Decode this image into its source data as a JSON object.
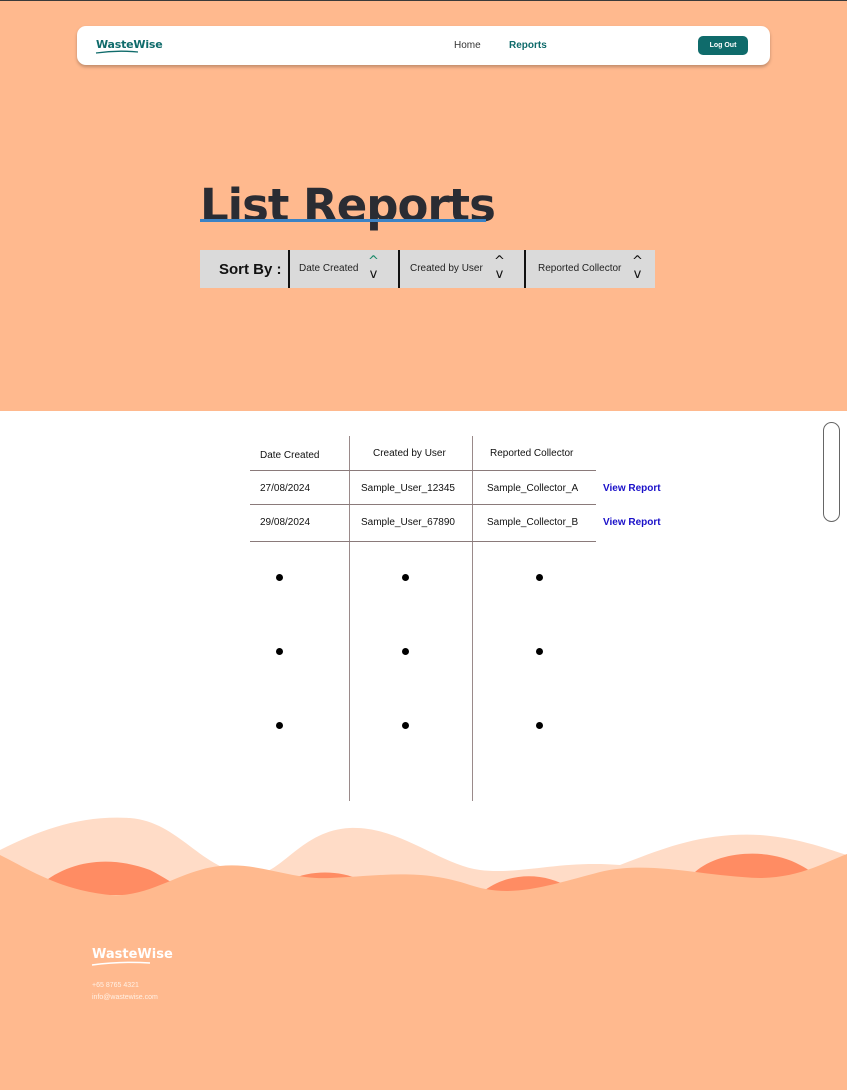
{
  "brand": {
    "name": "WasteWise"
  },
  "nav": {
    "home": "Home",
    "reports": "Reports",
    "logout": "Log Out"
  },
  "page": {
    "title": "List Reports"
  },
  "sort": {
    "label": "Sort By :",
    "options": [
      {
        "label": "Date Created",
        "up": "^",
        "down": "v"
      },
      {
        "label": "Created by User",
        "up": "^",
        "down": "v"
      },
      {
        "label": "Reported Collector",
        "up": "^",
        "down": "v"
      }
    ]
  },
  "table": {
    "headers": [
      "Date Created",
      "Created by User",
      "Reported Collector"
    ],
    "rows": [
      {
        "date": "27/08/2024",
        "user": "Sample_User_12345",
        "collector": "Sample_Collector_A",
        "action": "View Report"
      },
      {
        "date": "29/08/2024",
        "user": "Sample_User_67890",
        "collector": "Sample_Collector_B",
        "action": "View Report"
      }
    ]
  },
  "footer": {
    "brand": "WasteWise",
    "phone": "+65 8765 4321",
    "email": "info@wastewise.com"
  },
  "colors": {
    "hero": "#ffb98e",
    "brand": "#0f6b6b",
    "link": "#1a10c9",
    "underline": "#3b82c4"
  }
}
